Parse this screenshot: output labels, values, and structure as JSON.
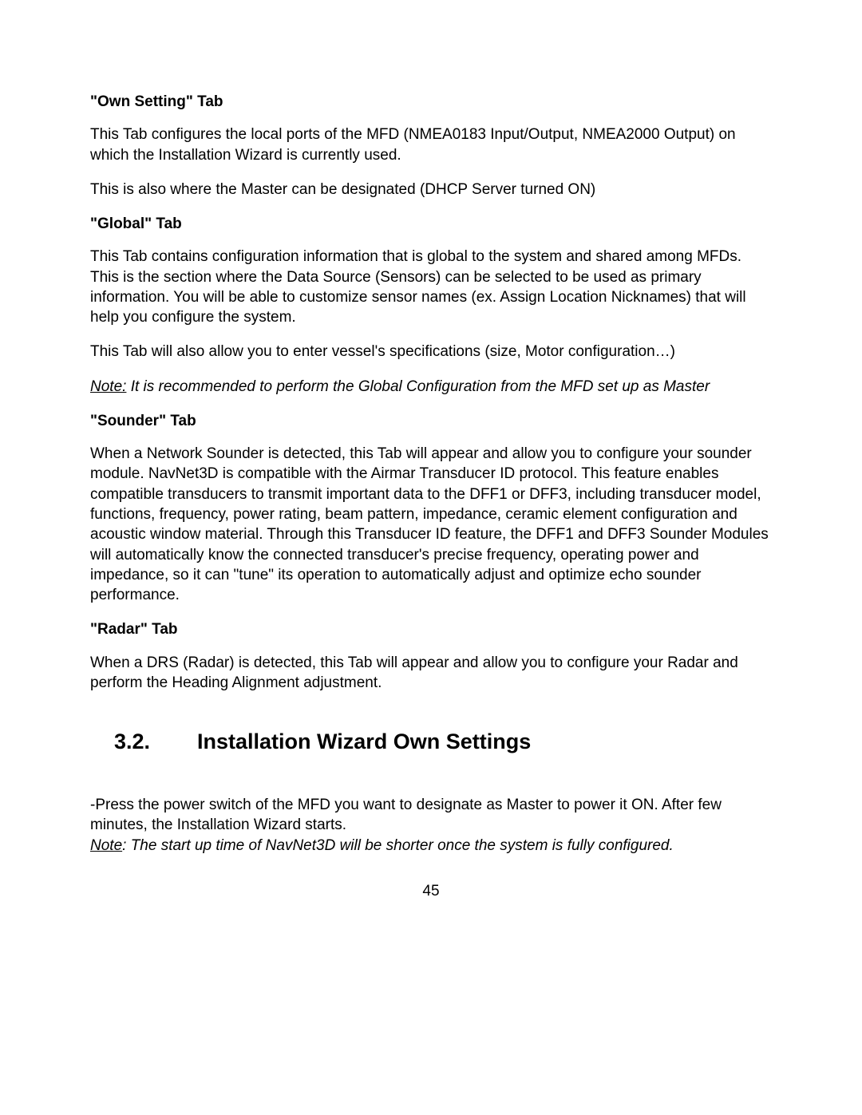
{
  "s1": {
    "heading": "\"Own Setting\" Tab",
    "p1": "This Tab configures the local ports of the MFD (NMEA0183 Input/Output, NMEA2000 Output) on which the Installation Wizard is currently used.",
    "p2": "This is also where the Master can be designated (DHCP Server turned ON)"
  },
  "s2": {
    "heading": "\"Global\" Tab",
    "p1a": "This Tab contains configuration information that is global to the system and shared among MFDs.",
    "p1b": "This is the section where the Data Source (Sensors) can be selected to be used as primary information. You will be able to customize sensor names (ex. Assign Location Nicknames) that will help you configure the system.",
    "p2": "This Tab will also allow you to enter vessel's specifications (size, Motor configuration…)",
    "note_label": "Note:",
    "note_text": " It is recommended to perform the Global Configuration from the MFD set up as Master"
  },
  "s3": {
    "heading": "\"Sounder\" Tab",
    "p1": "When a Network Sounder is detected, this Tab will appear and allow you to configure your sounder module. NavNet3D is compatible with the Airmar Transducer ID protocol. This feature enables compatible transducers to transmit important data to the DFF1 or DFF3, including transducer model, functions, frequency, power rating, beam pattern, impedance, ceramic element configuration and acoustic window material. Through this Transducer ID feature, the DFF1 and DFF3 Sounder Modules will automatically know the connected transducer's precise frequency, operating power and impedance, so it can \"tune\" its operation to automatically adjust and optimize echo sounder performance."
  },
  "s4": {
    "heading": "\"Radar\" Tab",
    "p1": "When a DRS (Radar) is detected, this Tab will appear and allow you to configure your Radar and perform the Heading Alignment adjustment."
  },
  "section": {
    "num": "3.2.",
    "title": "Installation Wizard Own Settings"
  },
  "s5": {
    "p1a": "-Press the power switch of the MFD you want to designate as Master to power it ON. After few minutes, the Installation Wizard starts.",
    "note_label": "Note",
    "note_text": ": The start up time of NavNet3D will be shorter once the system is fully configured."
  },
  "page_number": "45"
}
